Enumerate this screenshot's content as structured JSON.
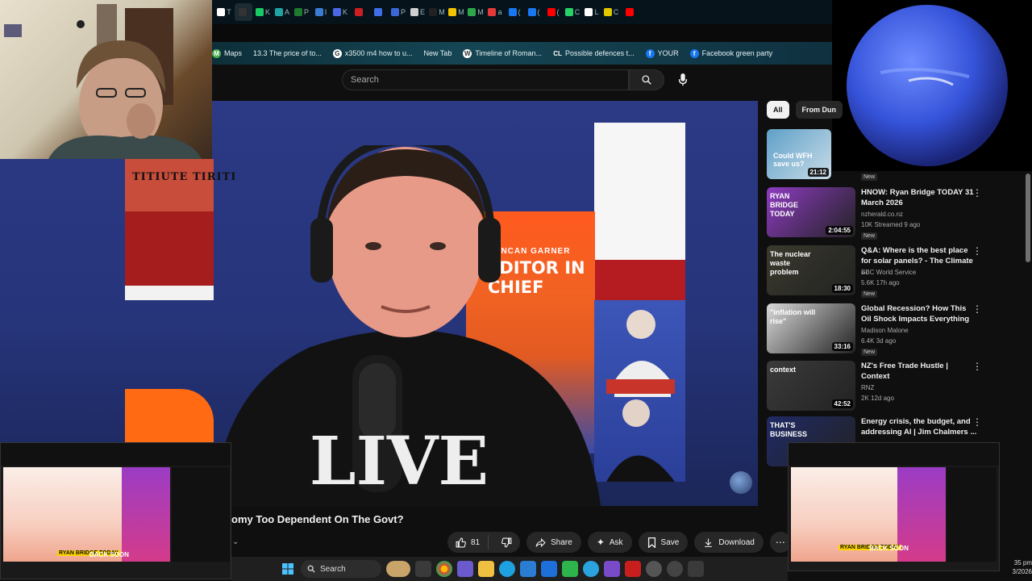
{
  "browser": {
    "tabs": [
      {
        "label": "T",
        "color": "#ffffff"
      },
      {
        "label": "",
        "color": "#333333",
        "active": true
      },
      {
        "label": "K",
        "color": "#18c964"
      },
      {
        "label": "A",
        "color": "#1fa3a3"
      },
      {
        "label": "P",
        "color": "#1e7a2e"
      },
      {
        "label": "I",
        "color": "#3a7bd5"
      },
      {
        "label": "K",
        "color": "#4a68e6"
      },
      {
        "label": "",
        "color": "#cc1f1f"
      },
      {
        "label": "",
        "color": "#3f6ee8"
      },
      {
        "label": "P",
        "color": "#3b66d8"
      },
      {
        "label": "E",
        "color": "#cfcfcf"
      },
      {
        "label": "M",
        "color": "#222222"
      },
      {
        "label": "M",
        "color": "#f2c300"
      },
      {
        "label": "M",
        "color": "#2ca84a"
      },
      {
        "label": "a",
        "color": "#e53935"
      },
      {
        "label": "(",
        "color": "#1877f2"
      },
      {
        "label": "(",
        "color": "#1877f2"
      },
      {
        "label": "(",
        "color": "#ff0000"
      },
      {
        "label": "C",
        "color": "#25d366"
      },
      {
        "label": "L",
        "color": "#ffffff"
      },
      {
        "label": "C",
        "color": "#e3c800"
      },
      {
        "label": "",
        "color": "#ff0000"
      }
    ],
    "bookmarks": [
      {
        "label": "Maps",
        "icon": "M",
        "color": "#4caf50"
      },
      {
        "label": "13.3 The price of to...",
        "icon": "",
        "color": "transparent"
      },
      {
        "label": "x3500 m4 how to u...",
        "icon": "G",
        "color": "#ffffff"
      },
      {
        "label": "New Tab",
        "icon": "",
        "color": "transparent"
      },
      {
        "label": "Timeline of Roman...",
        "icon": "W",
        "color": "#ffffff"
      },
      {
        "label": "Possible defences t...",
        "icon": "CL",
        "color": "transparent"
      },
      {
        "label": "YOUR",
        "icon": "f",
        "color": "#1877f2"
      },
      {
        "label": "Facebook green party",
        "icon": "f",
        "color": "#1877f2"
      }
    ]
  },
  "search": {
    "placeholder": "Search"
  },
  "video": {
    "stage_left_text": "TITIUTE TIRITI",
    "collage_subtitle": "DUNCAN GARNER",
    "collage_title": "EDITOR IN CHIEF",
    "shirt_text": "LIVE",
    "title": "omy Too Dependent On The Govt?",
    "likes": "81",
    "share": "Share",
    "ask": "Ask",
    "save": "Save",
    "download": "Download"
  },
  "sidebar": {
    "chips": [
      "All",
      "From Dun"
    ],
    "first_thumb_text": "Could WFH save us?",
    "first_duration": "21:12",
    "first_badge": "New",
    "items": [
      {
        "title": "HNOW: Ryan Bridge TODAY 31 March 2026",
        "channel": "nzherald.co.nz",
        "meta": "10K  Streamed 9 ago",
        "badge": "New",
        "duration": "2:04:55",
        "thumb_text": "RYAN BRIDGE TODAY",
        "thumb_color": "#8e3bc2"
      },
      {
        "title": "Q&A: Where is the best place for solar panels? - The Climate ...",
        "channel": "BBC World Service",
        "meta": "5.6K  17h ago",
        "badge": "New",
        "duration": "18:30",
        "thumb_text": "The nuclear waste problem",
        "thumb_color": "#3a3a2e"
      },
      {
        "title": "Global Recession? How This Oil Shock Impacts Everything",
        "channel": "Madison Malone",
        "meta": "6.4K  3d ago",
        "badge": "New",
        "duration": "33:16",
        "thumb_text": "\"inflation will rise\"",
        "thumb_color": "#d9d9d9"
      },
      {
        "title": "NZ's Free Trade Hustle | Context",
        "channel": "RNZ",
        "meta": "2K  12d ago",
        "badge": "",
        "duration": "42:52",
        "thumb_text": "context",
        "thumb_color": "#3b3b3b"
      },
      {
        "title": "Energy crisis, the budget, and addressing AI | Jim Chalmers ...",
        "channel": "",
        "meta": "",
        "badge": "",
        "duration": "",
        "thumb_text": "THAT'S BUSINESS",
        "thumb_color": "#1f2a66"
      }
    ]
  },
  "mini_left": {
    "back_soon": "BACK SOON",
    "brand": "RYAN BRIDGE TODAY"
  },
  "mini_right": {
    "back_soon": "BACK SOON",
    "brand": "RYAN BRIDGE TODAY"
  },
  "taskbar": {
    "search": "Search"
  },
  "clock": {
    "time": "35 pm",
    "date": "3/2026"
  }
}
